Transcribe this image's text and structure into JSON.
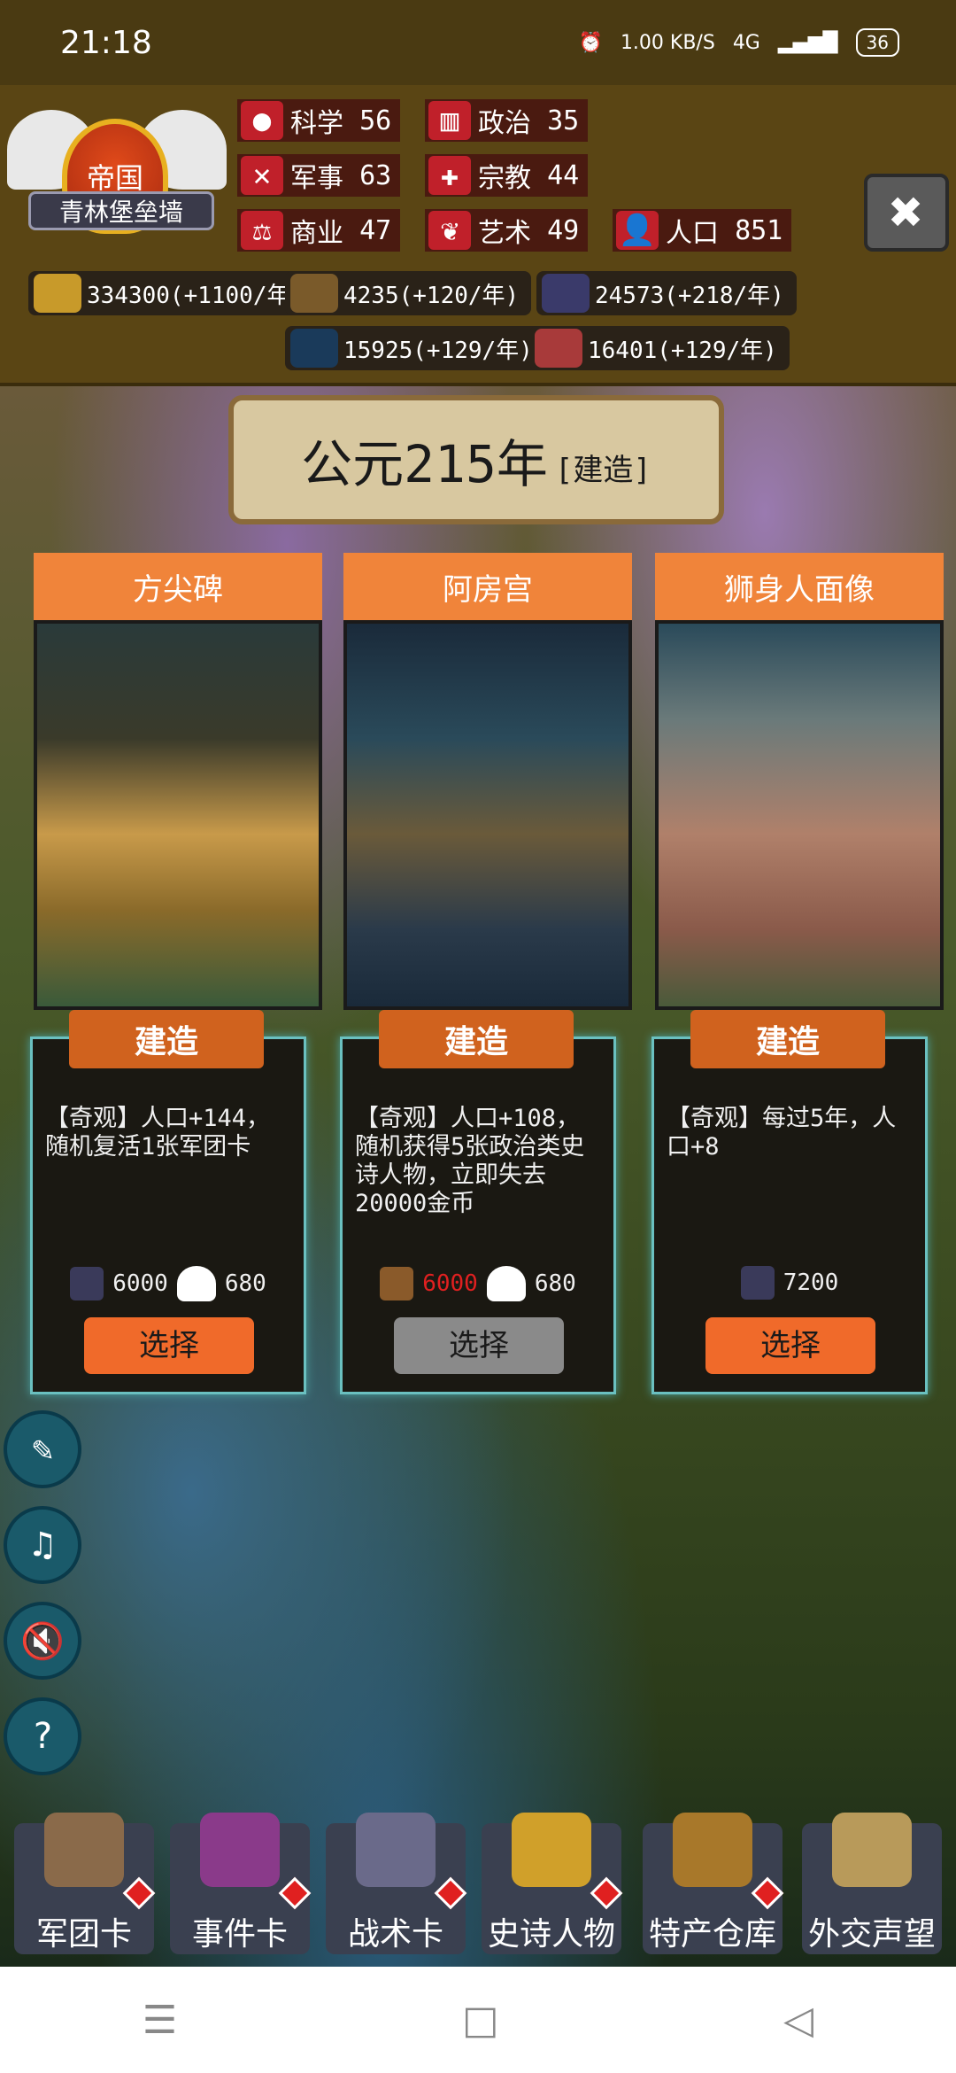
{
  "status": {
    "time": "21:18",
    "speed": "1.00 KB/S",
    "network": "4G",
    "battery": "36"
  },
  "header": {
    "emblem": {
      "rank": "帝国",
      "name": "青林堡垒墙"
    },
    "stats": [
      {
        "label": "科学",
        "value": "56",
        "icon": "science-icon"
      },
      {
        "label": "政治",
        "value": "35",
        "icon": "politics-icon"
      },
      {
        "label": "军事",
        "value": "63",
        "icon": "military-icon"
      },
      {
        "label": "宗教",
        "value": "44",
        "icon": "religion-icon"
      },
      {
        "label": "商业",
        "value": "47",
        "icon": "commerce-icon"
      },
      {
        "label": "艺术",
        "value": "49",
        "icon": "art-icon"
      },
      {
        "label": "人口",
        "value": "851",
        "icon": "population-icon"
      }
    ],
    "resources": [
      {
        "text": "334300(+1100/年)",
        "icon": "gold-coins-icon"
      },
      {
        "text": "4235(+120/年)",
        "icon": "wood-icon"
      },
      {
        "text": "24573(+218/年)",
        "icon": "stone-icon"
      },
      {
        "text": "15925(+129/年)",
        "icon": "tech-icon"
      },
      {
        "text": "16401(+129/年)",
        "icon": "meat-icon"
      }
    ]
  },
  "era": {
    "year": "公元215年",
    "phase": "[建造]"
  },
  "cards": [
    {
      "title": "方尖碑",
      "build_label": "建造",
      "desc": "【奇观】人口+144，随机复活1张军团卡",
      "cost1": "6000",
      "cost2": "680",
      "select_label": "选择",
      "enabled": true
    },
    {
      "title": "阿房宫",
      "build_label": "建造",
      "desc": "【奇观】人口+108，随机获得5张政治类史诗人物，立即失去20000金币",
      "cost1": "6000",
      "cost2": "680",
      "select_label": "选择",
      "enabled": false
    },
    {
      "title": "狮身人面像",
      "build_label": "建造",
      "desc": "【奇观】每过5年，人口+8",
      "cost1": "7200",
      "select_label": "选择",
      "enabled": true
    }
  ],
  "tabs": [
    {
      "label": "军团卡",
      "icon": "helmet-icon"
    },
    {
      "label": "事件卡",
      "icon": "scroll-icon"
    },
    {
      "label": "战术卡",
      "icon": "tactics-icon"
    },
    {
      "label": "史诗人物",
      "icon": "crown-icon"
    },
    {
      "label": "特产仓库",
      "icon": "chest-icon"
    },
    {
      "label": "外交声望",
      "icon": "envelope-icon"
    }
  ],
  "colors": {
    "accent": "#f0843a",
    "select_on": "#f06a2a",
    "select_off": "#8a8a8a",
    "card_border": "#6ac0c0",
    "stat_red": "#c0202a",
    "cost_insufficient": "#e02020"
  }
}
